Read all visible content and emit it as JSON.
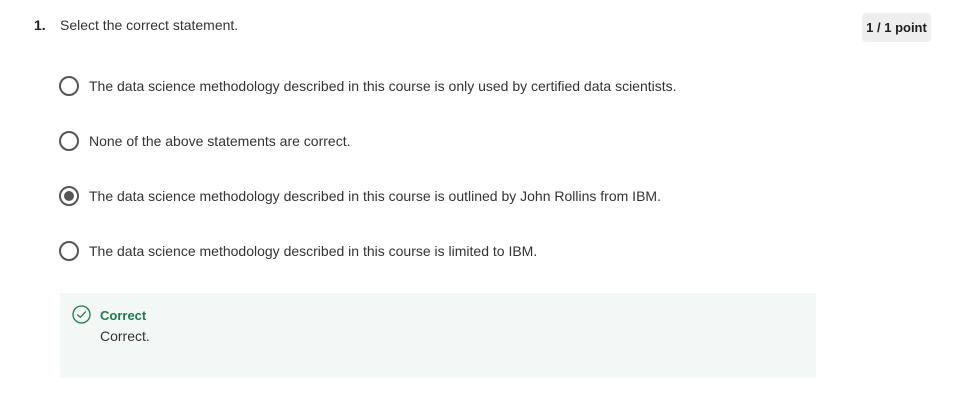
{
  "question": {
    "number": "1.",
    "text": "Select the correct statement.",
    "score": "1 / 1 point"
  },
  "options": [
    {
      "label": "The data science methodology described in this course is only used by certified data scientists.",
      "selected": false
    },
    {
      "label": "None of the above statements are correct.",
      "selected": false
    },
    {
      "label": "The data science methodology described in this course is outlined by John Rollins from IBM.",
      "selected": true
    },
    {
      "label": "The data science methodology described in this course is limited to IBM.",
      "selected": false
    }
  ],
  "feedback": {
    "title": "Correct",
    "text": "Correct.",
    "icon": "check-circle-icon"
  },
  "colors": {
    "success": "#1e7a4f",
    "feedback_bg": "#f3f8f6",
    "radio": "#555555",
    "badge_bg": "#eeeeee"
  }
}
